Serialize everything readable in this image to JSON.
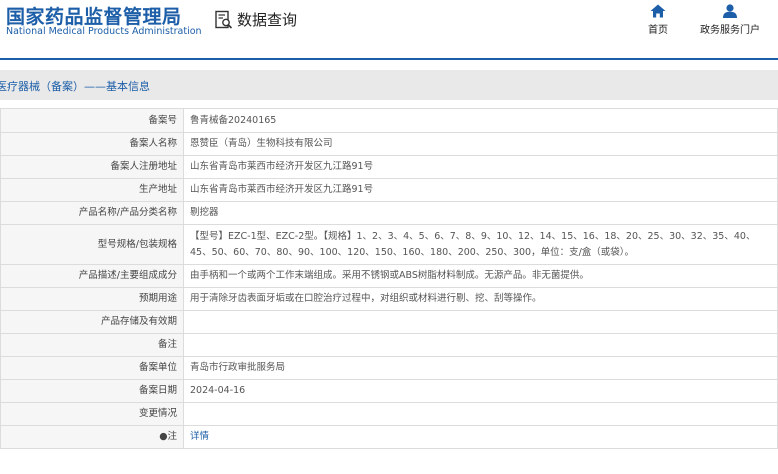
{
  "header": {
    "org_cn": "国家药品监督管理局",
    "org_en": "National Medical Products Administration",
    "query_label": "数据查询",
    "nav": [
      {
        "label": "首页",
        "icon": "home-icon"
      },
      {
        "label": "政务服务门户",
        "icon": "user-icon"
      }
    ]
  },
  "section": {
    "title": "医疗器械（备案）——基本信息"
  },
  "records": [
    {
      "label": "备案号",
      "value": "鲁青械备20240165"
    },
    {
      "label": "备案人名称",
      "value": "恩赞臣（青岛）生物科技有限公司"
    },
    {
      "label": "备案人注册地址",
      "value": "山东省青岛市莱西市经济开发区九江路91号"
    },
    {
      "label": "生产地址",
      "value": "山东省青岛市莱西市经济开发区九江路91号"
    },
    {
      "label": "产品名称/产品分类名称",
      "value": "剔挖器"
    },
    {
      "label": "型号规格/包装规格",
      "value": "【型号】EZC-1型、EZC-2型。【规格】1、2、3、4、5、6、7、8、9、10、12、14、15、16、18、20、25、30、32、35、40、45、50、60、70、80、90、100、120、150、160、180、200、250、300，单位：支/盒（或袋）。"
    },
    {
      "label": "产品描述/主要组成成分",
      "value": "由手柄和一个或两个工作末端组成。采用不锈钢或ABS树脂材料制成。无源产品。非无菌提供。"
    },
    {
      "label": "预期用途",
      "value": "用于清除牙齿表面牙垢或在口腔治疗过程中，对组织或材料进行剔、挖、刮等操作。"
    },
    {
      "label": "产品存储及有效期",
      "value": ""
    },
    {
      "label": "备注",
      "value": ""
    },
    {
      "label": "备案单位",
      "value": "青岛市行政审批服务局"
    },
    {
      "label": "备案日期",
      "value": "2024-04-16"
    },
    {
      "label": "变更情况",
      "value": ""
    },
    {
      "label": "注",
      "value": "详情",
      "link": true
    }
  ],
  "colors": {
    "brand": "#1c5ea8",
    "label_bg": "#f6f6f6",
    "border": "#dcdcdc",
    "bar_bg": "#e9e9e9"
  }
}
